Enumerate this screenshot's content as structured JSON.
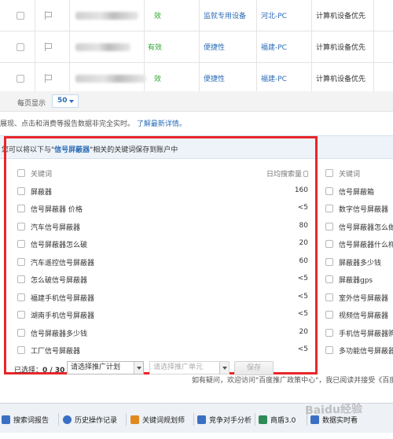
{
  "top_rows": [
    {
      "status": "效",
      "device": "监就专用设备",
      "region": "河北-PC",
      "category": "计算机设备优先"
    },
    {
      "status": "有效",
      "device": "便捷性",
      "region": "福建-PC",
      "category": "计算机设备优先"
    },
    {
      "status": "效",
      "device": "便捷性",
      "region": "福建-PC",
      "category": "计算机设备优先"
    }
  ],
  "per_page": {
    "label": "每页显示",
    "value": "50"
  },
  "note": {
    "text": "展现、点击和消费等报告数据非完全实时。",
    "link": "了解最新详情。"
  },
  "suggestion": {
    "prefix": "您可以将以下与\"",
    "keyword": "信号屏蔽器",
    "suffix": "\"相关的关键词保存到账户中",
    "col_keyword": "关键词",
    "col_volume": "日均搜索量",
    "rows": [
      {
        "name": "屏蔽器",
        "volume": "160"
      },
      {
        "name": "信号屏蔽器 价格",
        "volume": "<5"
      },
      {
        "name": "汽车信号屏蔽器",
        "volume": "80"
      },
      {
        "name": "信号屏蔽器怎么破",
        "volume": "20"
      },
      {
        "name": "汽车遥控信号屏蔽器",
        "volume": "60"
      },
      {
        "name": "怎么破信号屏蔽器",
        "volume": "<5"
      },
      {
        "name": "福建手机信号屏蔽器",
        "volume": "<5"
      },
      {
        "name": "湖南手机信号屏蔽器",
        "volume": "<5"
      },
      {
        "name": "信号屏蔽器多少钱",
        "volume": "20"
      },
      {
        "name": "工厂信号屏蔽器",
        "volume": "<5"
      }
    ],
    "right_rows": [
      {
        "name": "关键词"
      },
      {
        "name": "信号屏蔽箱"
      },
      {
        "name": "数字信号屏蔽器"
      },
      {
        "name": "信号屏蔽器怎么做"
      },
      {
        "name": "信号屏蔽器什么样"
      },
      {
        "name": "屏蔽器多少钱"
      },
      {
        "name": "屏蔽器gps"
      },
      {
        "name": "室外信号屏蔽器"
      },
      {
        "name": "视频信号屏蔽器"
      },
      {
        "name": "手机信号屏蔽器购"
      },
      {
        "name": "多功能信号屏蔽器"
      }
    ]
  },
  "bottom": {
    "selected_label": "已选择：",
    "selected_value": "0 / 30",
    "plan_placeholder": "请选择推广计划",
    "unit_placeholder": "请选择推广单元",
    "save": "保存",
    "agree_text": "如有疑问，欢迎访问\"百度推广政策中心\"，我已阅读并接受《百度推",
    "agree_link": "百度推广政策中心"
  },
  "toolbar": [
    {
      "label": "搜索词报告",
      "icon": "search-report-icon",
      "color": "#3a6fc4"
    },
    {
      "label": "历史操作记录",
      "icon": "history-icon",
      "color": "#3a6fc4"
    },
    {
      "label": "关键词规划师",
      "icon": "keyword-planner-icon",
      "color": "#e08a1e"
    },
    {
      "label": "竞争对手分析",
      "icon": "competitor-icon",
      "color": "#3a6fc4"
    },
    {
      "label": "商盾3.0",
      "icon": "shield-icon",
      "color": "#2e8b57"
    },
    {
      "label": "数据实时看",
      "icon": "realtime-data-icon",
      "color": "#3a6fc4"
    }
  ],
  "watermark": "Baidu经验"
}
